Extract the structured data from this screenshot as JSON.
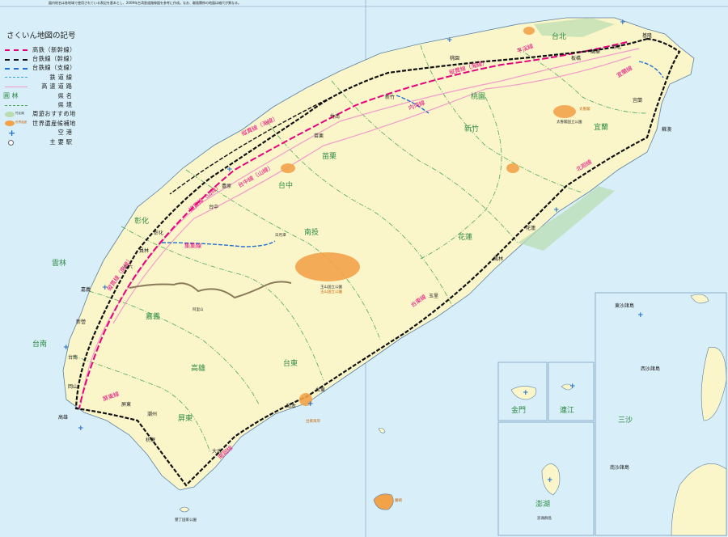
{
  "note": "図内地名は各地域で使用されている表記を基本とし、2009年台湾鉄道路線図を参考に作成。なお、離島関係の地図は縮尺が異なる。",
  "legend": {
    "title": "さくいん地図の記号",
    "items": [
      {
        "label": "高鉄（新幹線）",
        "symbol": "hsr"
      },
      {
        "label": "台鉄線（幹線）",
        "symbol": "trunk"
      },
      {
        "label": "台鉄線（支線）",
        "symbol": "branch"
      },
      {
        "label": "鉄道線",
        "symbol": "rail"
      },
      {
        "label": "高速道路",
        "symbol": "highway"
      },
      {
        "label": "県名",
        "symbol": "county-name",
        "sample": "圓 林"
      },
      {
        "label": "県境",
        "symbol": "county-border"
      },
      {
        "label": "周遊おすすめ地",
        "symbol": "scenic",
        "sample": "竹北湖"
      },
      {
        "label": "世界遺産候補地",
        "symbol": "heritage",
        "sample": "世界遺産"
      },
      {
        "label": "空港",
        "symbol": "airport"
      },
      {
        "label": "主要駅",
        "symbol": "station"
      }
    ]
  },
  "map": {
    "counties": [
      "台北",
      "宜蘭",
      "桃園",
      "新竹",
      "苗栗",
      "台中",
      "彰化",
      "南投",
      "花蓮",
      "雲林",
      "嘉義",
      "台南",
      "高雄",
      "台東",
      "屏東"
    ],
    "island_counties": [
      "金門",
      "連江",
      "澎湖"
    ],
    "outer_labels": [
      "東沙諸島",
      "西沙諸島",
      "南沙諸島",
      "三沙"
    ],
    "line_labels": [
      "縦貫線（海線）",
      "縦貫線（山線）",
      "台中線（山線）",
      "縦貫線（南線）",
      "集集線",
      "屏東線",
      "南廻線",
      "台東線",
      "北廻線",
      "宜蘭線",
      "平渓線",
      "内湾線",
      "縦貫線（海線）"
    ],
    "stations": [
      "基隆",
      "台北",
      "新竹",
      "苗栗",
      "台中",
      "彰化",
      "嘉義",
      "台南",
      "高雄",
      "屏東",
      "台東",
      "花蓮",
      "蘇澳",
      "宜蘭",
      "萬華",
      "板橋",
      "桃園",
      "竹南",
      "豊原",
      "員林",
      "斗六",
      "新營",
      "岡山",
      "潮州",
      "枋寮",
      "大武",
      "知本",
      "玉里",
      "鳳林"
    ],
    "scenic_spots": [
      "太魯閣国立公園",
      "玉山国立公園",
      "阿里山",
      "日月潭",
      "墾丁国家公園",
      "澎湖群島"
    ],
    "heritage_sites": [
      "玉山国立公園",
      "台東海岸",
      "蘭嶼",
      "太魯閣"
    ]
  },
  "colors": {
    "sea": "#d8eef8",
    "land": "#fbf6c9",
    "forest": "#b9ddb0",
    "hsr": "#e6007e",
    "trunk": "#111111",
    "branch": "#1f6fd0",
    "highway": "#f39acb",
    "county_border": "#4da85a",
    "county_name": "#2e8b46",
    "heritage": "#f2a34a",
    "railway_label": "#e6007e"
  }
}
